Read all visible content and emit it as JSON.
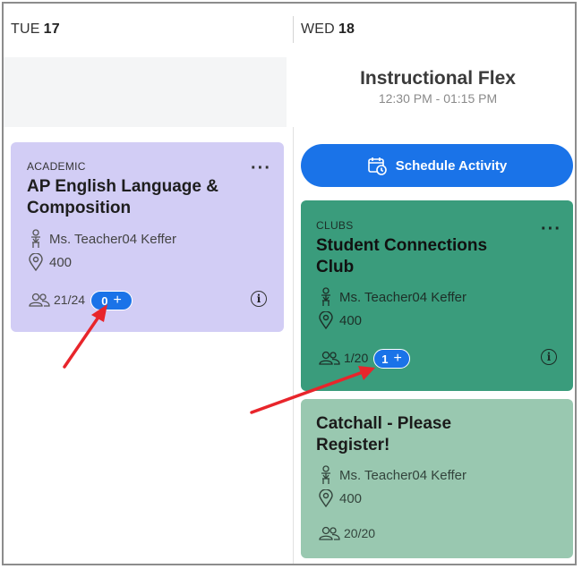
{
  "days": [
    {
      "dow": "TUE",
      "date": "17"
    },
    {
      "dow": "WED",
      "date": "18"
    }
  ],
  "period": {
    "title": "Instructional Flex",
    "time": "12:30 PM - 01:15 PM"
  },
  "schedule_button": {
    "label": "Schedule Activity"
  },
  "cards": [
    {
      "category": "ACADEMIC",
      "title_line1": "AP English Language &",
      "title_line2": "Composition",
      "teacher": "Ms. Teacher04 Keffer",
      "room": "400",
      "capacity": "21/24",
      "badge": "0",
      "color": "#d2cdf5"
    },
    {
      "category": "CLUBS",
      "title_line1": "Student Connections",
      "title_line2": "Club",
      "teacher": "Ms. Teacher04 Keffer",
      "room": "400",
      "capacity": "1/20",
      "badge": "1",
      "color": "#3a9c7c"
    },
    {
      "title_line1": "Catchall - Please",
      "title_line2": "Register!",
      "teacher": "Ms. Teacher04 Keffer",
      "room": "400",
      "capacity": "20/20",
      "color": "#99c8b0"
    }
  ],
  "icons": {
    "more": "more-horizontal-icon",
    "info": "info-icon",
    "teacher": "teacher-icon",
    "location": "location-pin-icon",
    "people": "people-icon",
    "calendar": "calendar-clock-icon"
  },
  "accent": "#1a73e8",
  "annotation_color": "#e8252b"
}
